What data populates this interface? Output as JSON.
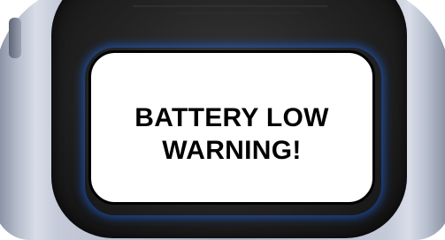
{
  "warning": {
    "line1": "BATTERY LOW",
    "line2": "WARNING!"
  }
}
